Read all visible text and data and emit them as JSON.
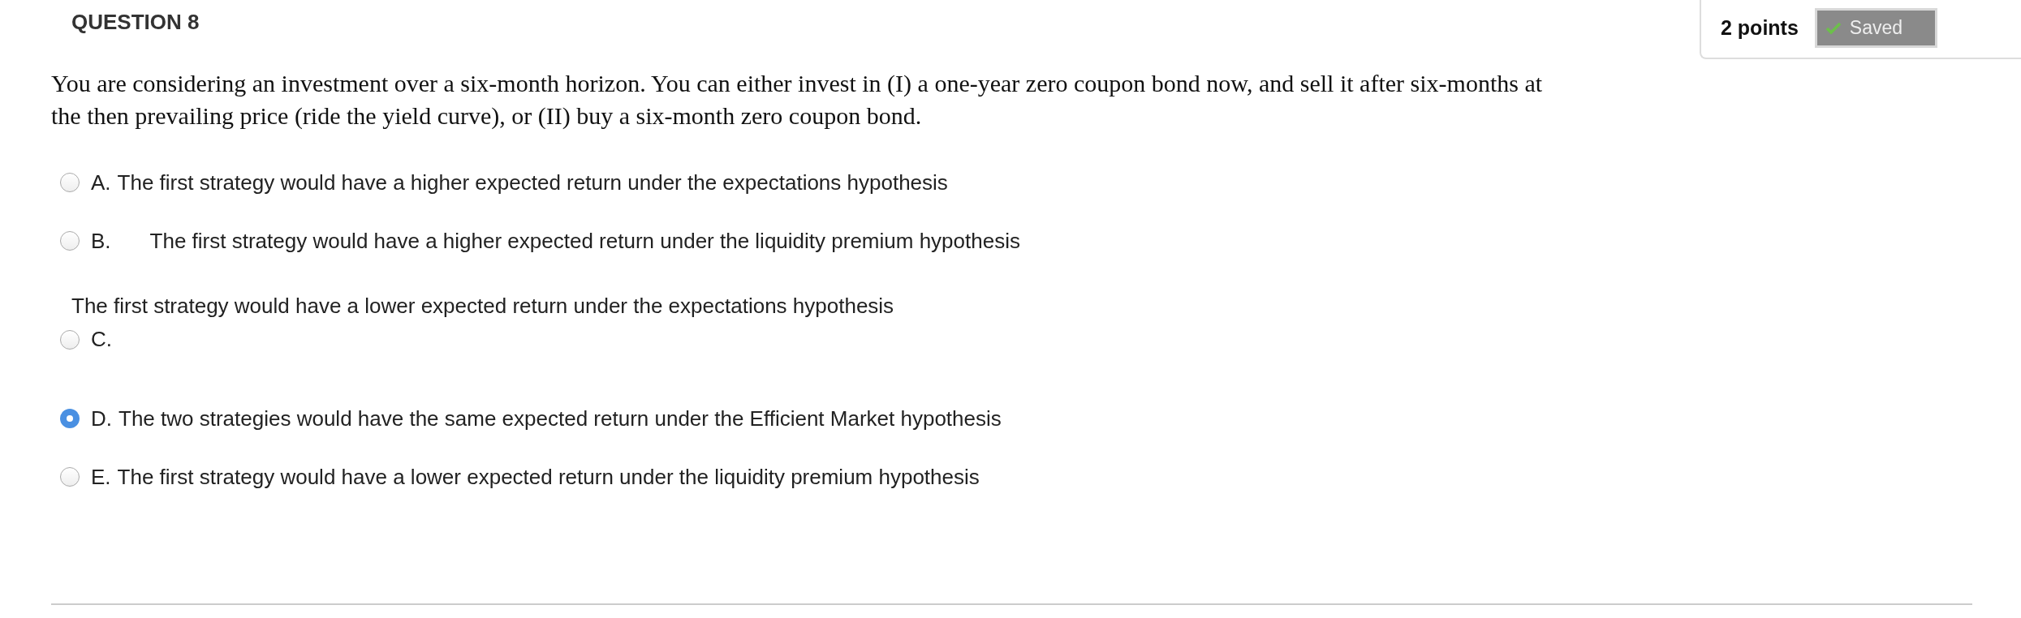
{
  "question": {
    "title": "QUESTION 8",
    "points": "2 points",
    "status": "Saved",
    "saved": true,
    "text": "You are considering an investment over a six-month horizon. You can either invest in (I) a one-year zero coupon bond now, and sell it after six-months at the then prevailing price (ride the yield curve), or (II) buy a six-month zero coupon bond."
  },
  "options": [
    {
      "kind": "inline",
      "letter": "A.",
      "text": "The first strategy would have a higher expected return under the expectations hypothesis",
      "selected": false
    },
    {
      "kind": "wrapped",
      "letter": "B.",
      "text": "The first strategy would have a higher expected return under the liquidity premium hypothesis",
      "selected": false
    },
    {
      "kind": "above",
      "letter": "C.",
      "text": "The first strategy would have a lower expected return under the expectations hypothesis",
      "selected": false
    },
    {
      "kind": "inline",
      "letter": "D.",
      "text": "The two strategies would have the same expected return under the Efficient Market hypothesis",
      "selected": true
    },
    {
      "kind": "inline",
      "letter": "E.",
      "text": "The first strategy would have a lower expected return under the liquidity premium hypothesis",
      "selected": false
    }
  ]
}
